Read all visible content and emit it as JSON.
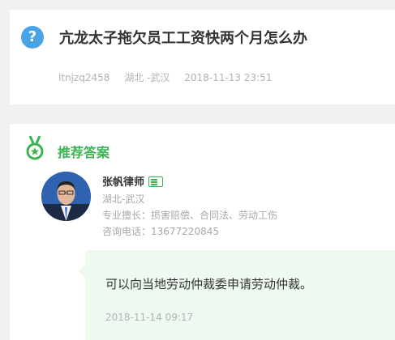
{
  "question": {
    "icon_glyph": "?",
    "title": "亢龙太子拖欠员工工资快两个月怎么办",
    "user": "ltnjzq2458",
    "location": "湖北 -武汉",
    "datetime": "2018-11-13 23:51"
  },
  "answer_section": {
    "header": "推荐答案",
    "lawyer": {
      "name": "张帆律师",
      "location": "湖北-武汉",
      "specialty": "专业擅长：损害赔偿、合同法、劳动工伤",
      "phone": "咨询电话：13677220845"
    },
    "answer": {
      "text": "可以向当地劳动仲裁委申请劳动仲裁。",
      "datetime": "2018-11-14 09:17"
    }
  },
  "colors": {
    "accent_green": "#3bb451",
    "question_blue": "#4aa3e6",
    "bubble_bg": "#eefaf0"
  },
  "icons": [
    "question-mark-icon",
    "medal-icon",
    "lawyer-badge-icon"
  ]
}
